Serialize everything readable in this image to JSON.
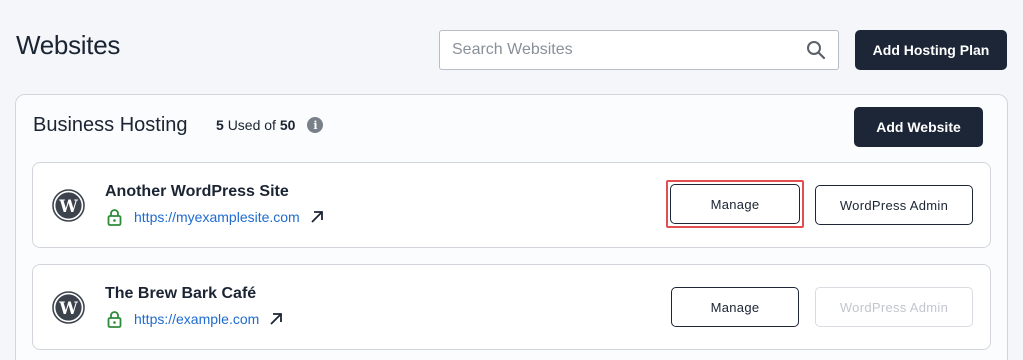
{
  "header": {
    "title": "Websites",
    "search_placeholder": "Search Websites",
    "add_plan_label": "Add Hosting Plan"
  },
  "plan": {
    "name": "Business Hosting",
    "used": "5",
    "used_text": "Used of",
    "total": "50",
    "info_glyph": "i",
    "add_website_label": "Add Website"
  },
  "sites": [
    {
      "name": "Another WordPress Site",
      "url": "https://myexamplesite.com",
      "manage_label": "Manage",
      "admin_label": "WordPress Admin",
      "admin_enabled": true,
      "manage_highlighted": true
    },
    {
      "name": "The Brew Bark Café",
      "url": "https://example.com",
      "manage_label": "Manage",
      "admin_label": "WordPress Admin",
      "admin_enabled": false,
      "manage_highlighted": false
    }
  ],
  "colors": {
    "accent_dark": "#1d2637",
    "link": "#1f6bd0",
    "lock_green": "#2e8b3a",
    "highlight_red": "#e05050"
  },
  "icons": {
    "search": "search-icon",
    "info": "info-icon",
    "wordpress": "wordpress-icon",
    "lock": "lock-icon",
    "external": "external-link-icon"
  }
}
